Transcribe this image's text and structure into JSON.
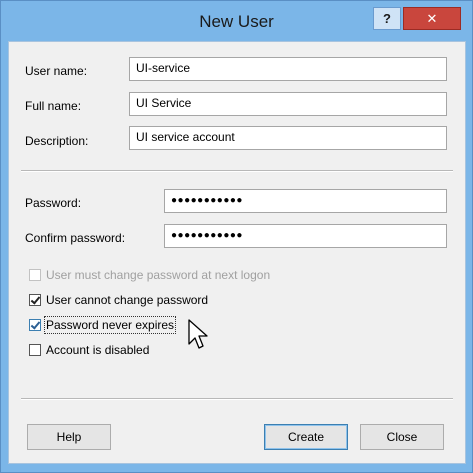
{
  "window": {
    "title": "New User",
    "help_glyph": "?",
    "close_glyph": "✕"
  },
  "form": {
    "username_label": "User name:",
    "username_value": "UI-service",
    "fullname_label": "Full name:",
    "fullname_value": "UI Service",
    "description_label": "Description:",
    "description_value": "UI service account",
    "password_label": "Password:",
    "password_mask": "●●●●●●●●●●●",
    "confirm_label": "Confirm password:",
    "confirm_mask": "●●●●●●●●●●●"
  },
  "options": [
    {
      "label": "User must change password at next logon",
      "checked": false,
      "disabled": true
    },
    {
      "label": "User cannot change password",
      "checked": true,
      "disabled": false
    },
    {
      "label": "Password never expires",
      "checked": true,
      "disabled": false,
      "focused": true
    },
    {
      "label": "Account is disabled",
      "checked": false,
      "disabled": false
    }
  ],
  "buttons": {
    "help": "Help",
    "create": "Create",
    "close": "Close"
  },
  "icons": {
    "checkbox": "checkbox-icon",
    "cursor": "mouse-pointer-icon"
  }
}
